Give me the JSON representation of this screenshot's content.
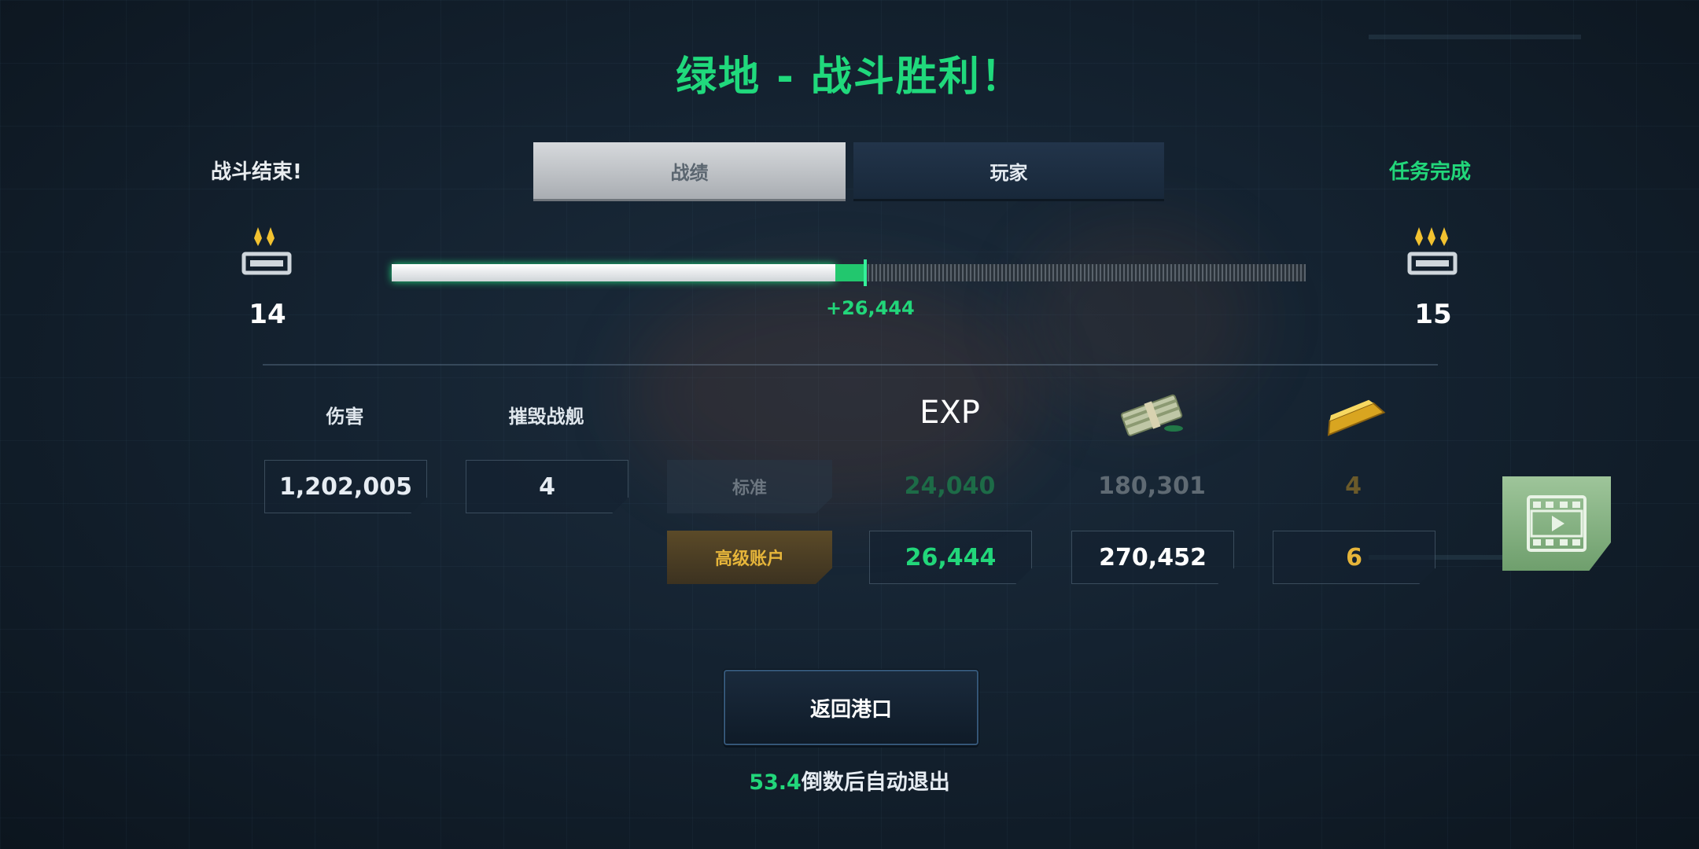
{
  "title": "绿地 - 战斗胜利！",
  "left_status": "战斗结束!",
  "right_status": "任务完成",
  "tabs": [
    {
      "label": "战绩",
      "active": true
    },
    {
      "label": "玩家",
      "active": false
    }
  ],
  "rank": {
    "current": "14",
    "next": "15",
    "icon": "rank-chevron-icon"
  },
  "progress": {
    "previous_fraction": 0.485,
    "current_fraction": 0.518,
    "gain_text": "+26,444"
  },
  "stats": {
    "damage_label": "伤害",
    "damage_value": "1,202,005",
    "kills_label": "摧毁战舰",
    "kills_value": "4"
  },
  "rewards": {
    "exp_label": "EXP",
    "credits_icon": "credits-cash-icon",
    "gold_icon": "gold-bar-icon",
    "standard": {
      "label": "标准",
      "exp": "24,040",
      "credits": "180,301",
      "gold": "4"
    },
    "premium": {
      "label": "高级账户",
      "exp": "26,444",
      "credits": "270,452",
      "gold": "6"
    }
  },
  "video_button_icon": "film-play-icon",
  "return_button": "返回港口",
  "countdown": {
    "seconds": "53.4",
    "suffix": "倒数后自动退出"
  },
  "colors": {
    "accent_green": "#20d97c",
    "gold": "#e6b53a",
    "background": "#142230"
  }
}
